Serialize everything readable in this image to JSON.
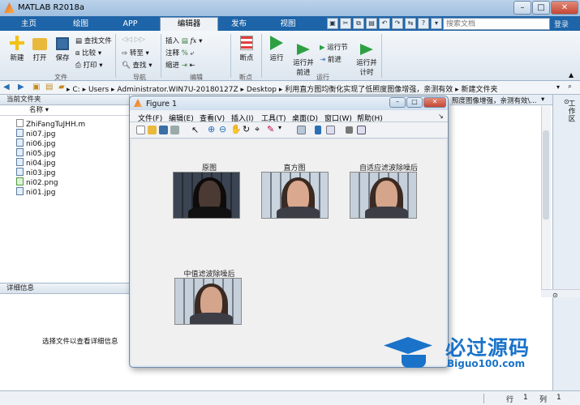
{
  "app": {
    "title": "MATLAB R2018a"
  },
  "tabs": [
    {
      "label": "主页"
    },
    {
      "label": "绘图"
    },
    {
      "label": "APP"
    },
    {
      "label": "编辑器"
    },
    {
      "label": "发布"
    },
    {
      "label": "视图"
    }
  ],
  "search": {
    "placeholder": "搜索文档"
  },
  "login": "登录",
  "ribbon": {
    "file": {
      "new": "新建",
      "open": "打开",
      "save": "保存",
      "find_files": "查找文件",
      "compare": "比较",
      "print": "打印",
      "group": "文件"
    },
    "nav": {
      "goto": "转至",
      "find": "查找",
      "group": "导航"
    },
    "edit": {
      "insert": "插入",
      "comment": "注释",
      "indent": "缩进",
      "group": "编辑"
    },
    "breakpoints": {
      "label": "断点",
      "group": "断点"
    },
    "run": {
      "run": "运行",
      "run_advance": "运行并\n前进",
      "run_section": "运行节",
      "advance": "前进",
      "run_time": "运行并\n计时",
      "group": "运行"
    }
  },
  "address": {
    "segments": [
      "C:",
      "Users",
      "Administrator.WIN7U-20180127Z",
      "Desktop",
      "利用直方图均衡化实现了低照度图像增强，亲测有效",
      "新建文件夹"
    ]
  },
  "left_panel": {
    "title": "当前文件夹",
    "col_name": "名称",
    "files": [
      "ZhiFangTuJHH.m",
      "ni07.jpg",
      "ni06.jpg",
      "ni05.jpg",
      "ni04.jpg",
      "ni03.jpg",
      "ni02.png",
      "ni01.jpg"
    ],
    "detail_title": "详细信息",
    "detail_hint": "选择文件以查看详细信息"
  },
  "right_panel": {
    "partial_text": "照度图像增强，亲测有效\\...",
    "side_label": "工作区"
  },
  "figure": {
    "title": "Figure 1",
    "menus": [
      "文件(F)",
      "编辑(E)",
      "查看(V)",
      "插入(I)",
      "工具(T)",
      "桌面(D)",
      "窗口(W)",
      "帮助(H)"
    ],
    "plots": [
      {
        "title": "原图"
      },
      {
        "title": "直方图"
      },
      {
        "title": "自适应滤波除噪后"
      },
      {
        "title": "中值滤波除噪后"
      }
    ]
  },
  "status": {
    "row_label": "行",
    "row": "1",
    "col_label": "列",
    "col": "1"
  },
  "watermark": {
    "brand": "必过源码",
    "url": "Biguo100.com"
  },
  "colors": {
    "tabbar": "#1e64a8",
    "accent": "#2a6fb5"
  }
}
